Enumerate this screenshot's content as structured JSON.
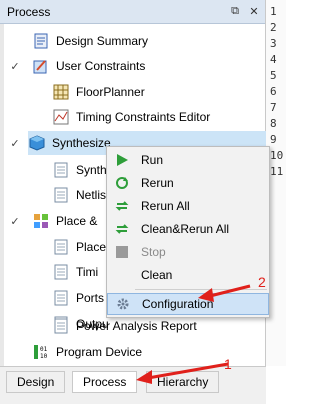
{
  "panel": {
    "title": "Process",
    "float_glyph": "⧉",
    "close_glyph": "✕"
  },
  "tree": [
    {
      "label": "Design Summary",
      "icon": "design-summary-icon"
    },
    {
      "label": "User Constraints",
      "icon": "user-constraints-icon"
    },
    {
      "label": "FloorPlanner",
      "icon": "floorplanner-icon"
    },
    {
      "label": "Timing Constraints Editor",
      "icon": "timing-editor-icon"
    },
    {
      "label": "Synthesize",
      "icon": "synthesize-icon"
    },
    {
      "label": "Synth",
      "icon": "document-icon"
    },
    {
      "label": "Netlis",
      "icon": "document-icon"
    },
    {
      "label": "Place &",
      "icon": "place-route-icon"
    },
    {
      "label": "Place",
      "icon": "document-icon"
    },
    {
      "label": "Timi",
      "icon": "document-icon"
    },
    {
      "label": "Ports",
      "icon": "document-icon"
    },
    {
      "label": "Outpu",
      "icon": "document-icon"
    },
    {
      "label": "Power Analysis Report",
      "icon": "document-icon"
    },
    {
      "label": "Program Device",
      "icon": "program-device-icon"
    }
  ],
  "context_menu": {
    "items": [
      "Run",
      "Rerun",
      "Rerun All",
      "Clean&Rerun All",
      "Stop",
      "Clean",
      "Configuration"
    ]
  },
  "tabs": [
    "Design",
    "Process",
    "Hierarchy"
  ],
  "line_numbers": [
    "1",
    "2",
    "3",
    "4",
    "5",
    "6",
    "7",
    "8",
    "9",
    "10",
    "11"
  ],
  "annotations": {
    "one": "1",
    "two": "2"
  },
  "colors": {
    "highlight": "#cce4f7",
    "arrow": "#e0201b",
    "run_green": "#2e9e3a"
  }
}
